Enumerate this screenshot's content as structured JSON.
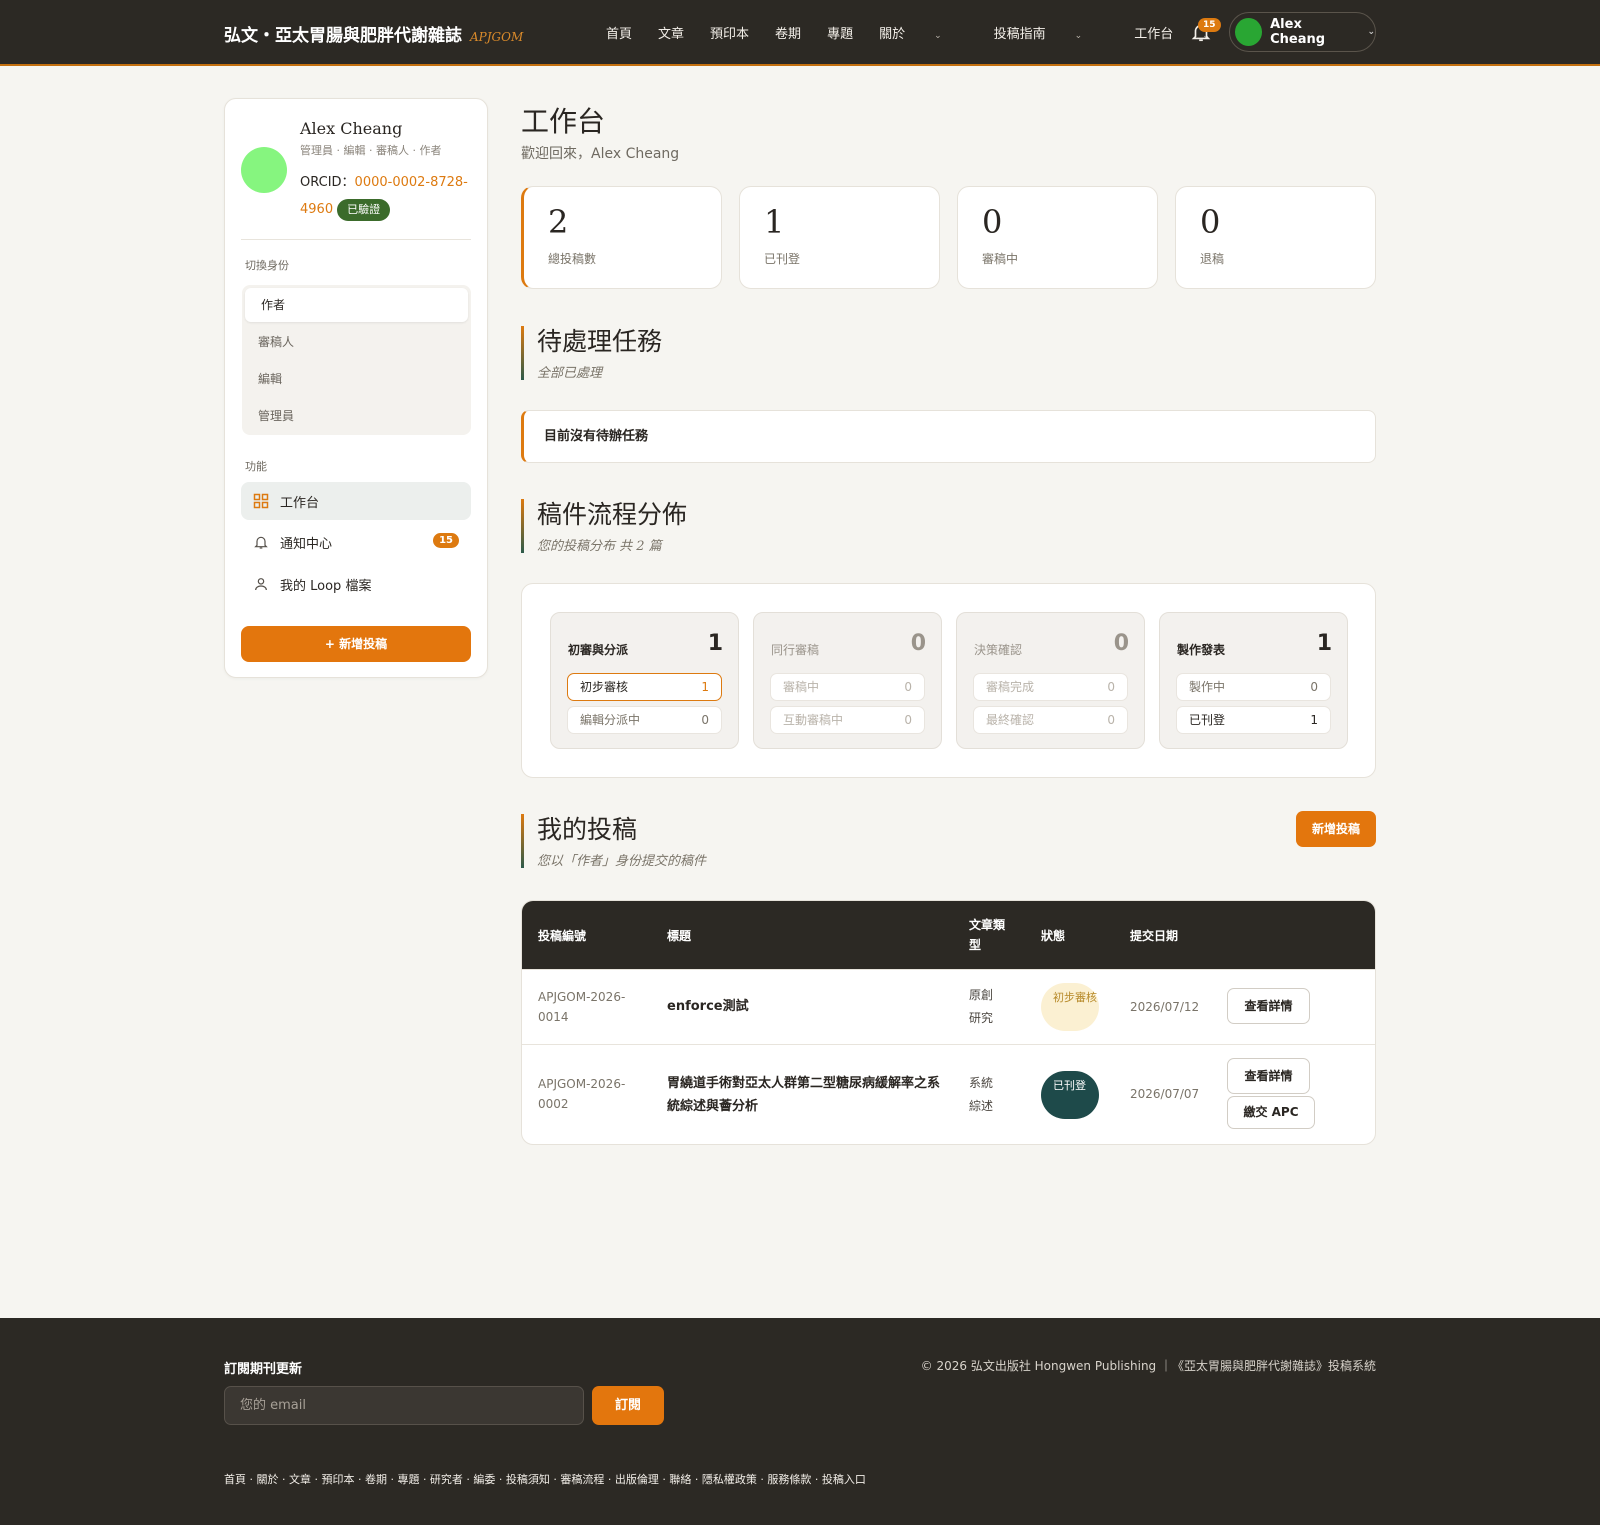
{
  "header": {
    "brand": "弘文・亞太胃腸與肥胖代謝雜誌",
    "brand_abbr": "APJGOM",
    "nav": [
      {
        "label": "首頁"
      },
      {
        "label": "文章"
      },
      {
        "label": "預印本"
      },
      {
        "label": "卷期"
      },
      {
        "label": "專題"
      },
      {
        "label": "關於"
      },
      {
        "label": "投稿指南"
      },
      {
        "label": "工作台"
      }
    ],
    "notification_count": "15",
    "user_name": "Alex Cheang"
  },
  "sidebar": {
    "name": "Alex Cheang",
    "roles": "管理員 · 編輯 · 審稿人 · 作者",
    "orcid_label": "ORCID：",
    "orcid": "0000-0002-8728-4960",
    "verified": "已驗證",
    "switch_label": "切換身份",
    "role_options": [
      "作者",
      "審稿人",
      "編輯",
      "管理員"
    ],
    "functions_label": "功能",
    "functions": [
      {
        "label": "工作台"
      },
      {
        "label": "通知中心",
        "badge": "15"
      },
      {
        "label": "我的 Loop 檔案"
      }
    ],
    "new_submission": "+ 新增投稿"
  },
  "main": {
    "title": "工作台",
    "welcome": "歡迎回來，Alex Cheang",
    "stats": [
      {
        "value": "2",
        "label": "總投稿數"
      },
      {
        "value": "1",
        "label": "已刊登"
      },
      {
        "value": "0",
        "label": "審稿中"
      },
      {
        "value": "0",
        "label": "退稿"
      }
    ],
    "pending": {
      "title": "待處理任務",
      "subtitle": "全部已處理",
      "empty_message": "目前沒有待辦任務"
    },
    "flow": {
      "title": "稿件流程分佈",
      "subtitle": "您的投稿分布 共 2 篇",
      "stages": [
        {
          "title": "初審與分派",
          "count": "1",
          "subs": [
            {
              "label": "初步審核",
              "count": "1"
            },
            {
              "label": "編輯分派中",
              "count": "0"
            }
          ]
        },
        {
          "title": "同行審稿",
          "count": "0",
          "subs": [
            {
              "label": "審稿中",
              "count": "0"
            },
            {
              "label": "互動審稿中",
              "count": "0"
            }
          ]
        },
        {
          "title": "決策確認",
          "count": "0",
          "subs": [
            {
              "label": "審稿完成",
              "count": "0"
            },
            {
              "label": "最終確認",
              "count": "0"
            }
          ]
        },
        {
          "title": "製作發表",
          "count": "1",
          "subs": [
            {
              "label": "製作中",
              "count": "0"
            },
            {
              "label": "已刊登",
              "count": "1"
            }
          ]
        }
      ]
    },
    "submissions": {
      "title": "我的投稿",
      "subtitle": "您以「作者」身份提交的稿件",
      "new_button": "新增投稿",
      "columns": [
        "投稿編號",
        "標題",
        "文章類型",
        "狀態",
        "提交日期"
      ],
      "rows": [
        {
          "id": "APJGOM-2026-0014",
          "title": "enforce測試",
          "type": "原創研究",
          "status": "初步審核",
          "date": "2026/07/12",
          "actions": [
            "查看詳情"
          ]
        },
        {
          "id": "APJGOM-2026-0002",
          "title": "胃繞道手術對亞太人群第二型糖尿病緩解率之系統綜述與薈分析",
          "type": "系統綜述",
          "status": "已刊登",
          "date": "2026/07/07",
          "actions": [
            "查看詳情",
            "繳交 APC"
          ]
        }
      ]
    }
  },
  "footer": {
    "subscribe_title": "訂閱期刊更新",
    "email_placeholder": "您的 email",
    "subscribe_button": "訂閱",
    "copyright": "© 2026 弘文出版社 Hongwen Publishing ｜《亞太胃腸與肥胖代謝雜誌》投稿系統",
    "links": "首頁 · 關於 · 文章 · 預印本 · 卷期 · 專題 · 研究者 · 編委 · 投稿須知 · 審稿流程 · 出版倫理 · 聯絡 · 隱私權政策 · 服務條款 · 投稿入口"
  },
  "colors": {
    "accent": "#e3760d",
    "header_bg": "#2c2924",
    "published": "#1e4a4a",
    "verified": "#3b6b2b"
  }
}
